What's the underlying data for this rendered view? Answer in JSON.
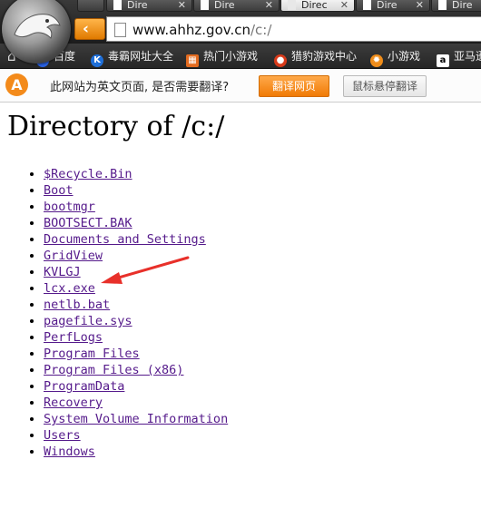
{
  "browser": {
    "tabs": [
      {
        "label": "Dire",
        "active": false
      },
      {
        "label": "Dire",
        "active": false
      },
      {
        "label": "Direc",
        "active": true
      },
      {
        "label": "Dire",
        "active": false
      },
      {
        "label": "Dire",
        "active": false
      }
    ],
    "address": {
      "host": "www.ahhz.gov.cn",
      "path": "/c:/"
    },
    "bookmarks": [
      {
        "label": "百度",
        "icon": "paw-icon",
        "color": "#2a62e4"
      },
      {
        "label": "毒霸网址大全",
        "icon": "k-icon",
        "color": "#1e6fd9"
      },
      {
        "label": "热门小游戏",
        "icon": "game-icon",
        "color": "#e36b1f"
      },
      {
        "label": "猎豹游戏中心",
        "icon": "cheetah-icon",
        "color": "#d83a1a"
      },
      {
        "label": "小游戏",
        "icon": "flame-icon",
        "color": "#f08d1a"
      },
      {
        "label": "亚马逊",
        "icon": "amazon-icon",
        "color": "#ffffff"
      }
    ]
  },
  "translate_bar": {
    "message": "此网站为英文页面, 是否需要翻译?",
    "translate_button": "翻译网页",
    "hover_button": "鼠标悬停翻译"
  },
  "page": {
    "title": "Directory of /c:/",
    "entries": [
      "$Recycle.Bin",
      "Boot",
      "bootmgr",
      "BOOTSECT.BAK",
      "Documents and Settings",
      "GridView",
      "KVLGJ",
      "lcx.exe",
      "netlb.bat",
      "pagefile.sys",
      "PerfLogs",
      "Program Files",
      "Program Files (x86)",
      "ProgramData",
      "Recovery",
      "System Volume Information",
      "Users",
      "Windows"
    ]
  },
  "colors": {
    "link": "#551a8b",
    "accent": "#f07a05",
    "annotation_arrow": "#e8302a"
  }
}
